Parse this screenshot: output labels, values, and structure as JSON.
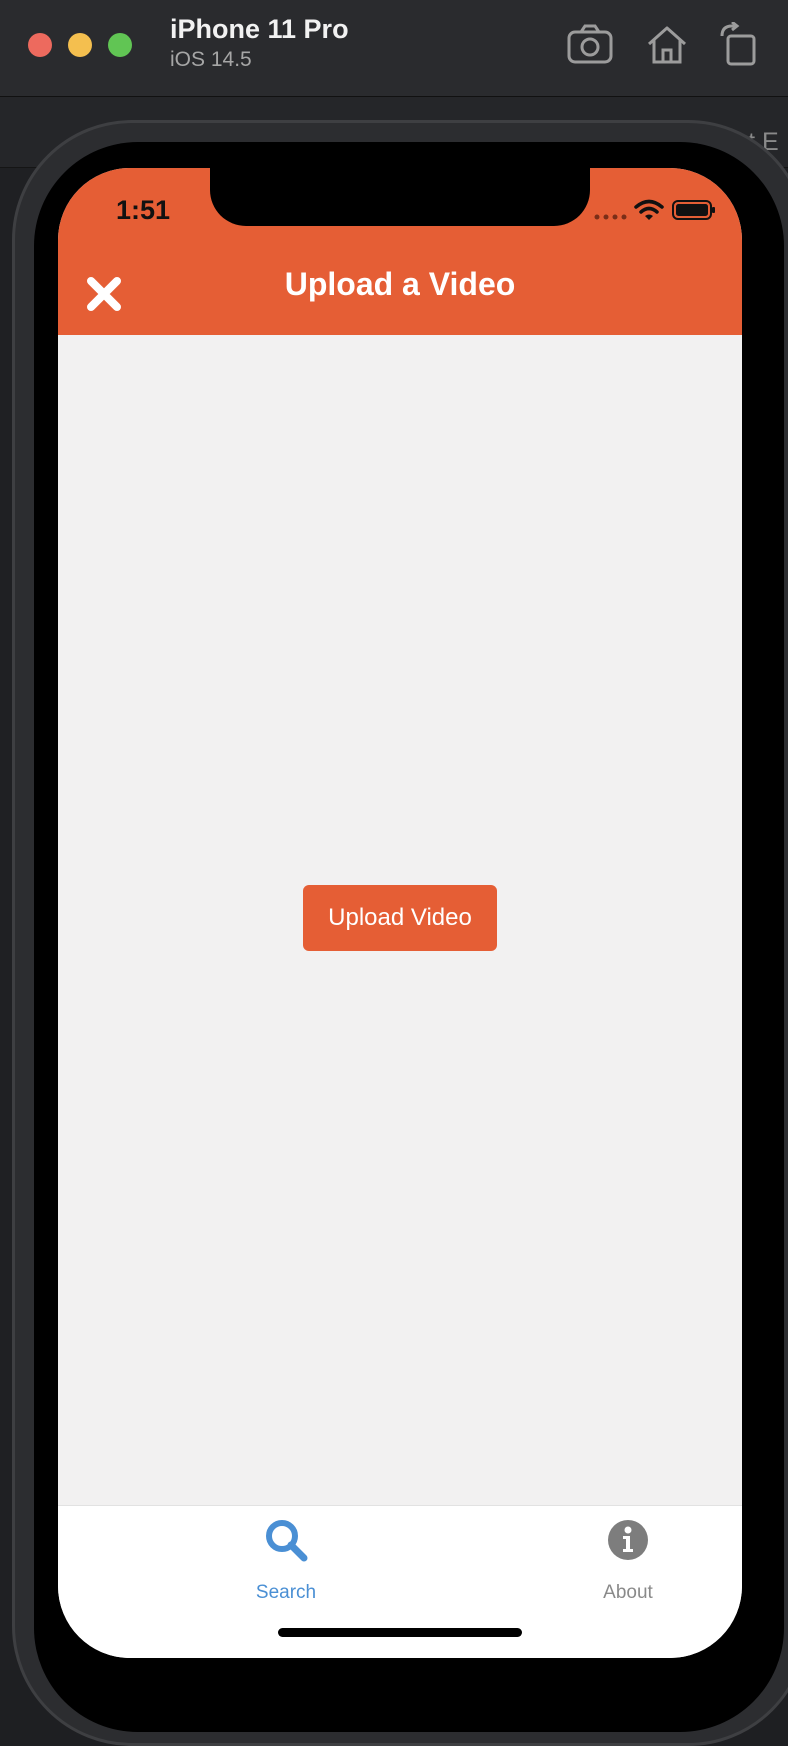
{
  "simulator": {
    "device": "iPhone 11 Pro",
    "os": "iOS 14.5",
    "icons": [
      "camera-icon",
      "home-icon",
      "rotate-icon"
    ]
  },
  "background_fragments": {
    "port_text": "port E"
  },
  "status_bar": {
    "time": "1:51"
  },
  "header": {
    "title": "Upload a Video",
    "close_icon": "close-icon",
    "color": "#e55e35"
  },
  "main": {
    "upload_button_label": "Upload Video"
  },
  "tabs": [
    {
      "label": "Search",
      "icon": "search-icon",
      "active": true,
      "color": "#4a8fd4"
    },
    {
      "label": "About",
      "icon": "info-icon",
      "active": false,
      "color": "#8a8a8a"
    }
  ]
}
